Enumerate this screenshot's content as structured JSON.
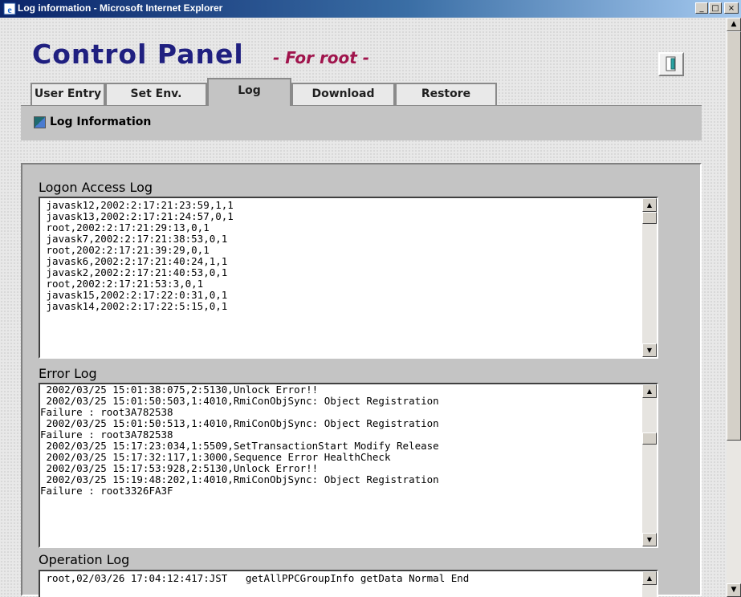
{
  "window": {
    "title": "Log information - Microsoft Internet Explorer",
    "minimize": "_",
    "maximize": "□",
    "close": "×"
  },
  "header": {
    "title": "Control Panel",
    "subtitle": "- For root -"
  },
  "tabs": [
    {
      "label": "User Entry",
      "active": false
    },
    {
      "label": "Set Env.",
      "active": false
    },
    {
      "label": "Log",
      "active": true
    },
    {
      "label": "Download",
      "active": false
    },
    {
      "label": "Restore",
      "active": false
    }
  ],
  "subnav": {
    "label": "Log Information"
  },
  "logs": {
    "logon": {
      "label": "Logon Access Log",
      "lines": [
        " javask12,2002:2:17:21:23:59,1,1",
        " javask13,2002:2:17:21:24:57,0,1",
        " root,2002:2:17:21:29:13,0,1",
        " javask7,2002:2:17:21:38:53,0,1",
        " root,2002:2:17:21:39:29,0,1",
        " javask6,2002:2:17:21:40:24,1,1",
        " javask2,2002:2:17:21:40:53,0,1",
        " root,2002:2:17:21:53:3,0,1",
        " javask15,2002:2:17:22:0:31,0,1",
        " javask14,2002:2:17:22:5:15,0,1"
      ]
    },
    "error": {
      "label": "Error Log",
      "lines": [
        " 2002/03/25 15:01:38:075,2:5130,Unlock Error!!",
        " 2002/03/25 15:01:50:503,1:4010,RmiConObjSync: Object Registration",
        "Failure : root3A782538",
        " 2002/03/25 15:01:50:513,1:4010,RmiConObjSync: Object Registration",
        "Failure : root3A782538",
        " 2002/03/25 15:17:23:034,1:5509,SetTransactionStart Modify Release",
        " 2002/03/25 15:17:32:117,1:3000,Sequence Error HealthCheck",
        " 2002/03/25 15:17:53:928,2:5130,Unlock Error!!",
        " 2002/03/25 15:19:48:202,1:4010,RmiConObjSync: Object Registration",
        "Failure : root3326FA3F"
      ]
    },
    "operation": {
      "label": "Operation Log",
      "lines": [
        " root,02/03/26 17:04:12:417:JST   getAllPPCGroupInfo getData Normal End"
      ]
    }
  }
}
